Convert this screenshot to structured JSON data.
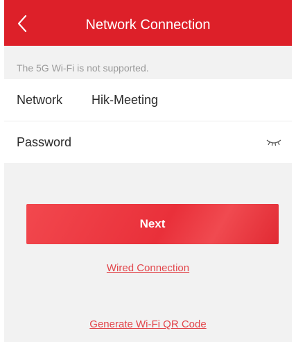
{
  "header": {
    "title": "Network Connection"
  },
  "hint": "The 5G Wi-Fi is not supported.",
  "form": {
    "network_label": "Network",
    "network_value": "Hik-Meeting",
    "password_label": "Password",
    "password_value": "",
    "password_visibility_icon": "eye-closed-icon"
  },
  "actions": {
    "next_label": "Next",
    "wired_label": "Wired Connection",
    "qr_label": "Generate Wi-Fi QR Code"
  },
  "colors": {
    "brand_red": "#dd2029",
    "link_red": "#e2454a",
    "hint_gray": "#9a9a9a",
    "background": "#f2f2f2"
  }
}
